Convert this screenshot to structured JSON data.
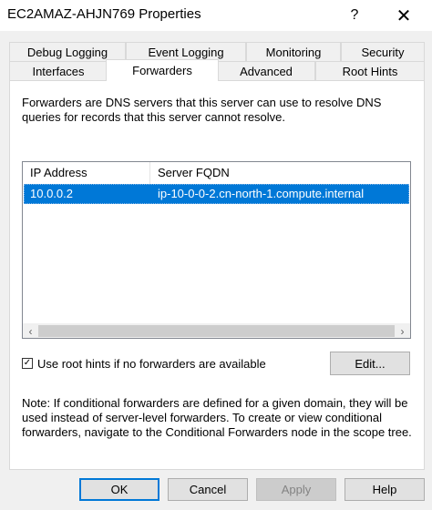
{
  "window": {
    "title": "EC2AMAZ-AHJN769 Properties",
    "help_glyph": "?",
    "close_glyph": "✕"
  },
  "tabs": {
    "back_row": [
      "Debug Logging",
      "Event Logging",
      "Monitoring",
      "Security"
    ],
    "front_row": [
      "Interfaces",
      "Forwarders",
      "Advanced",
      "Root Hints"
    ],
    "active": "Forwarders"
  },
  "forwarders": {
    "description": "Forwarders are DNS servers that this server can use to resolve DNS queries for records that this server cannot resolve.",
    "columns": [
      "IP Address",
      "Server FQDN"
    ],
    "rows": [
      {
        "ip": "10.0.0.2",
        "fqdn": "ip-10-0-0-2.cn-north-1.compute.internal",
        "selected": true
      }
    ],
    "use_root_hints_label": "Use root hints if no forwarders are available",
    "use_root_hints_checked": true,
    "edit_label": "Edit...",
    "note": "Note: If conditional forwarders are defined for a given domain, they will be used instead of server-level forwarders.  To create or view conditional forwarders, navigate to the Conditional Forwarders node in the scope tree."
  },
  "buttons": {
    "ok": "OK",
    "cancel": "Cancel",
    "apply": "Apply",
    "help": "Help"
  },
  "colors": {
    "selection": "#0078d7",
    "default_button_border": "#0078d7"
  }
}
